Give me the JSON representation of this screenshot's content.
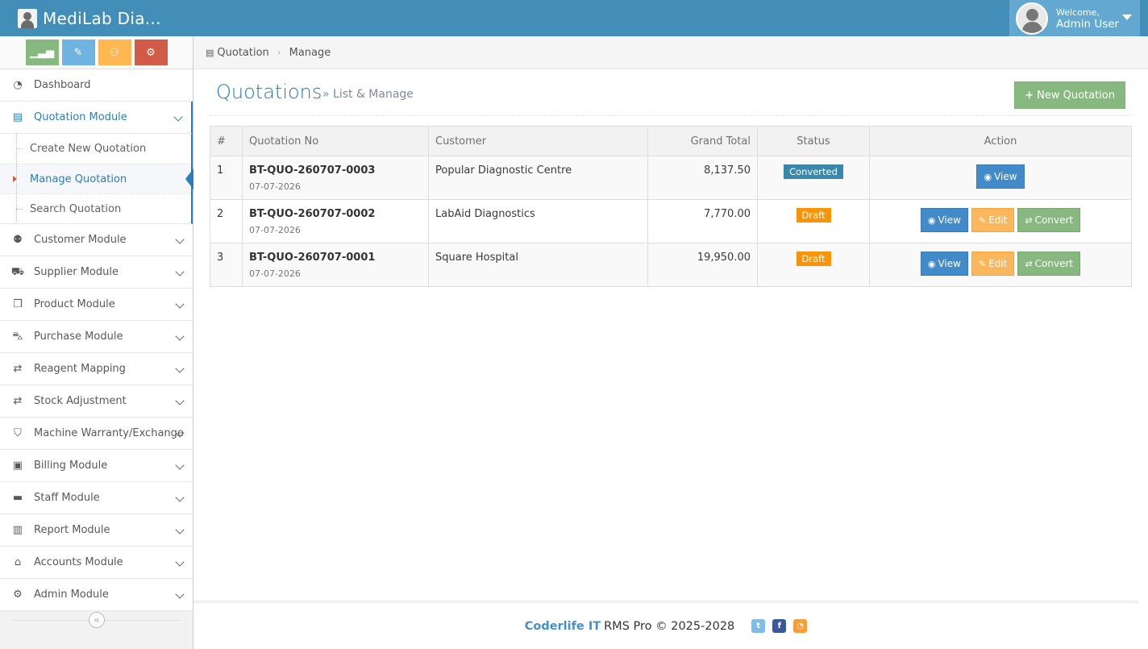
{
  "app": {
    "title": "MediLab Dia..."
  },
  "user": {
    "welcome": "Welcome,",
    "name": "Admin User"
  },
  "breadcrumb": {
    "root": "Quotation",
    "current": "Manage"
  },
  "sidebar": {
    "shortcut_colors": [
      "#87b87f",
      "#6fb3e0",
      "#ffb752",
      "#d15b47"
    ],
    "items": [
      {
        "label": "Dashboard",
        "icon": "dashboard-icon"
      },
      {
        "label": "Quotation Module",
        "icon": "file-icon",
        "open": true,
        "children": [
          "Create New Quotation",
          "Manage Quotation",
          "Search Quotation"
        ]
      },
      {
        "label": "Customer Module",
        "icon": "users-icon"
      },
      {
        "label": "Supplier Module",
        "icon": "truck-icon"
      },
      {
        "label": "Product Module",
        "icon": "cubes-icon"
      },
      {
        "label": "Purchase Module",
        "icon": "cart-icon"
      },
      {
        "label": "Reagent Mapping",
        "icon": "exchange-icon"
      },
      {
        "label": "Stock Adjustment",
        "icon": "exchange-icon"
      },
      {
        "label": "Machine Warranty/Exchange",
        "icon": "shield-icon"
      },
      {
        "label": "Billing Module",
        "icon": "money-icon"
      },
      {
        "label": "Staff Module",
        "icon": "briefcase-icon"
      },
      {
        "label": "Report Module",
        "icon": "bar-chart-icon"
      },
      {
        "label": "Accounts Module",
        "icon": "bank-icon"
      },
      {
        "label": "Admin Module",
        "icon": "gear-icon"
      }
    ]
  },
  "page": {
    "title": "Quotations",
    "subtitle": "» List & Manage",
    "new_button": "New Quotation"
  },
  "table": {
    "headers": [
      "#",
      "Quotation No",
      "Customer",
      "Grand Total",
      "Status",
      "Action"
    ],
    "rows": [
      {
        "num": "1",
        "qno": "BT-QUO-260707-0003",
        "date": "07-07-2026",
        "customer": "Popular Diagnostic Centre",
        "total": "8,137.50",
        "status": "Converted"
      },
      {
        "num": "2",
        "qno": "BT-QUO-260707-0002",
        "date": "07-07-2026",
        "customer": "LabAid Diagnostics",
        "total": "7,770.00",
        "status": "Draft"
      },
      {
        "num": "3",
        "qno": "BT-QUO-260707-0001",
        "date": "07-07-2026",
        "customer": "Square Hospital",
        "total": "19,950.00",
        "status": "Draft"
      }
    ],
    "actions": {
      "view": "View",
      "edit": "Edit",
      "convert": "Convert"
    }
  },
  "footer": {
    "org": "Coderlife IT",
    "text": "RMS Pro © 2025-2028"
  }
}
